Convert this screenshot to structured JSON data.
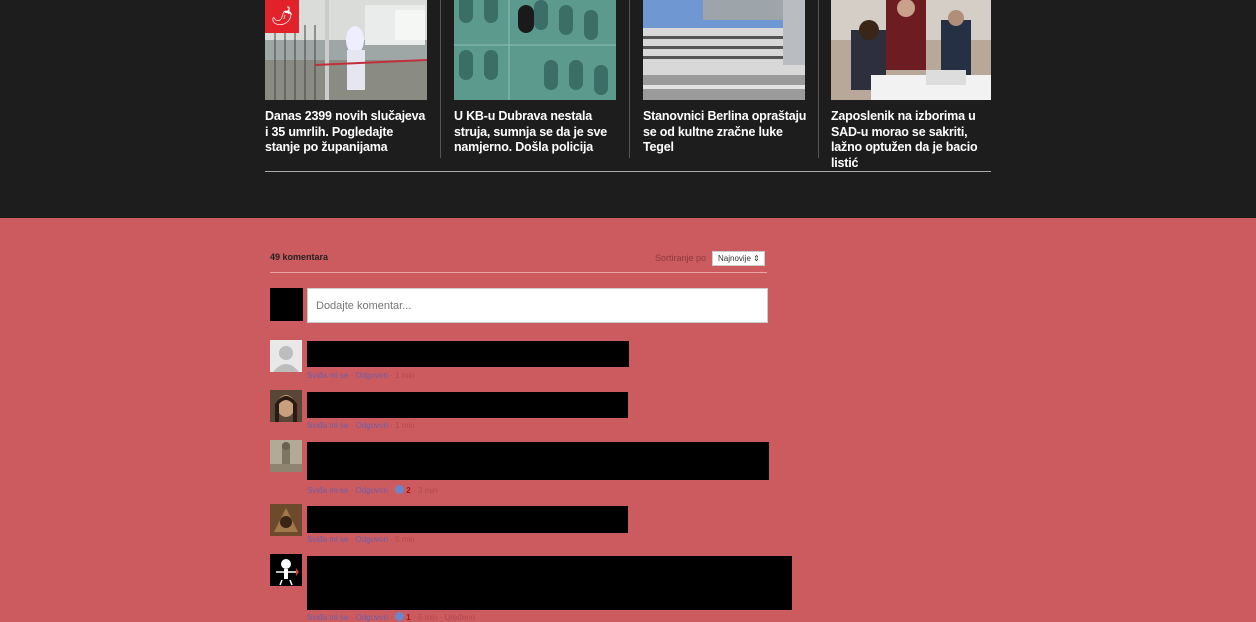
{
  "related": [
    {
      "title": "Danas 2399 novih slučajeva i 35 umrlih. Pogledajte stanje po županijama",
      "badge_icon": "pepper-icon"
    },
    {
      "title": "U KB-u Dubrava nestala struja, sumnja se da je sve namjerno. Došla policija"
    },
    {
      "title": "Stanovnici Berlina opraštaju se od kultne zračne luke Tegel"
    },
    {
      "title": "Zaposlenik na izborima u SAD-u morao se sakriti, lažno optužen da je bacio listić"
    }
  ],
  "comments_header": {
    "count": "49 komentara",
    "sort_label": "Sortiranje po",
    "sort_value": "Najnovije ⇕"
  },
  "composer": {
    "placeholder": "Dodajte komentar..."
  },
  "comments": [
    {
      "like": "Sviđa mi se",
      "reply": "Odgovori",
      "likes": "",
      "time": "1 min"
    },
    {
      "like": "Sviđa mi se",
      "reply": "Odgovori",
      "likes": "",
      "time": "1 min"
    },
    {
      "like": "Sviđa mi se",
      "reply": "Odgovori",
      "likes": "2",
      "time": "3 min"
    },
    {
      "like": "Sviđa mi se",
      "reply": "Odgovori",
      "likes": "",
      "time": "5 min"
    },
    {
      "like": "Sviđa mi se",
      "reply": "Odgovori",
      "likes": "1",
      "time": "5 min",
      "extra": "Uređeno"
    }
  ],
  "colors": {
    "page_bg": "#cc5b5f",
    "top_bg": "#1d1d1d",
    "badge": "#e2222a"
  }
}
